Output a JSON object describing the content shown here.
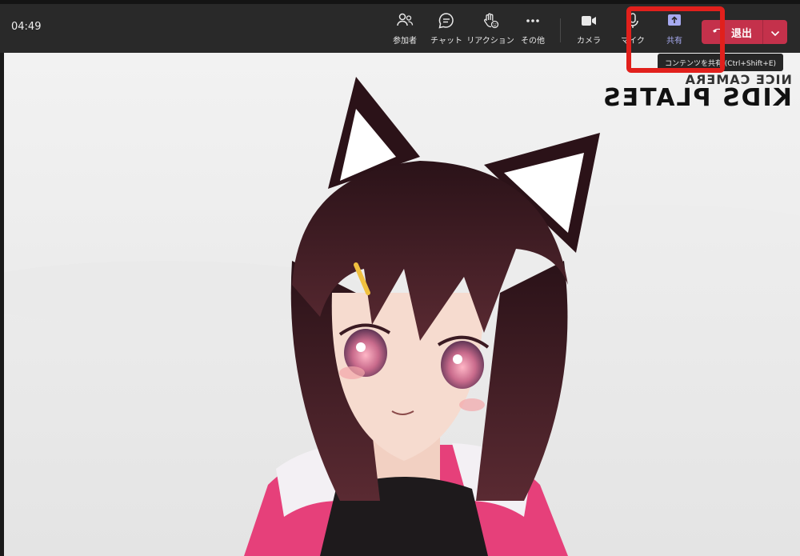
{
  "meeting": {
    "timer": "04:49"
  },
  "toolbar": {
    "participants_label": "参加者",
    "chat_label": "チャット",
    "reactions_label": "リアクション",
    "more_label": "その他",
    "camera_label": "カメラ",
    "mic_label": "マイク",
    "share_label": "共有",
    "leave_label": "退出"
  },
  "tooltip": {
    "text": "コンテンツを共有 (Ctrl+Shift+E)"
  },
  "video": {
    "background_text_line1": "NICE CAMERA",
    "background_text_line2": "KIDS PLATES"
  },
  "colors": {
    "leave": "#c4314b",
    "accent": "#a7aaf0",
    "highlight": "#e1201c",
    "toolbar": "#292929"
  }
}
